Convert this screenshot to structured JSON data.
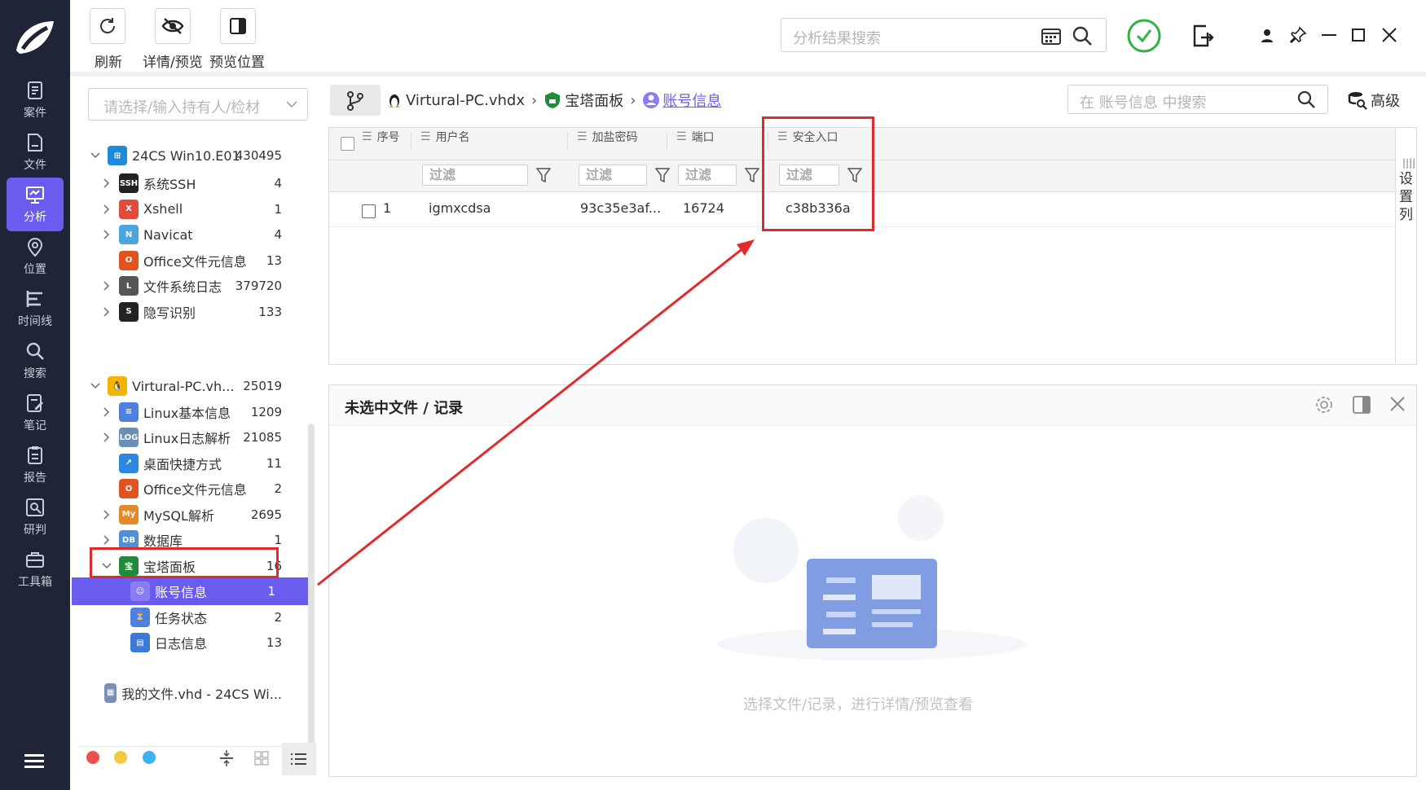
{
  "toolbar": {
    "refresh_label": "刷新",
    "detail_label": "详情/预览",
    "preview_pos_label": "预览位置",
    "search_placeholder": "分析结果搜索"
  },
  "nav": {
    "items": [
      {
        "label": "案件",
        "icon": "case-icon"
      },
      {
        "label": "文件",
        "icon": "file-icon"
      },
      {
        "label": "分析",
        "icon": "analysis-icon",
        "active": true
      },
      {
        "label": "位置",
        "icon": "location-icon"
      },
      {
        "label": "时间线",
        "icon": "timeline-icon"
      },
      {
        "label": "搜索",
        "icon": "search-icon"
      },
      {
        "label": "笔记",
        "icon": "note-icon"
      },
      {
        "label": "报告",
        "icon": "report-icon"
      },
      {
        "label": "研判",
        "icon": "judge-icon"
      },
      {
        "label": "工具箱",
        "icon": "toolbox-icon"
      }
    ]
  },
  "tree": {
    "select_placeholder": "请选择/输入持有人/检材",
    "groups": [
      {
        "label": "24CS Win10.E01",
        "count": "430495",
        "children": [
          {
            "label": "系统SSH",
            "count": "4"
          },
          {
            "label": "Xshell",
            "count": "1"
          },
          {
            "label": "Navicat",
            "count": "4"
          },
          {
            "label": "Office文件元信息",
            "count": "13"
          },
          {
            "label": "文件系统日志",
            "count": "379720"
          },
          {
            "label": "隐写识别",
            "count": "133"
          }
        ]
      },
      {
        "label": "Virtural-PC.vh...",
        "count": "25019",
        "children": [
          {
            "label": "Linux基本信息",
            "count": "1209"
          },
          {
            "label": "Linux日志解析",
            "count": "21085"
          },
          {
            "label": "桌面快捷方式",
            "count": "11"
          },
          {
            "label": "Office文件元信息",
            "count": "2"
          },
          {
            "label": "MySQL解析",
            "count": "2695"
          },
          {
            "label": "数据库",
            "count": "1"
          },
          {
            "label": "宝塔面板",
            "count": "16"
          },
          {
            "label": "账号信息",
            "count": "1"
          },
          {
            "label": "任务状态",
            "count": "2"
          },
          {
            "label": "日志信息",
            "count": "13"
          }
        ]
      },
      {
        "label": "我的文件.vhd - 24CS Wi...",
        "count": ""
      }
    ]
  },
  "breadcrumb": {
    "item1": "Virtural-PC.vhdx",
    "item2": "宝塔面板",
    "item3": "账号信息",
    "search_placeholder": "在 账号信息 中搜索",
    "advanced_label": "高级"
  },
  "grid": {
    "columns": [
      "序号",
      "用户名",
      "加盐密码",
      "端口",
      "安全入口"
    ],
    "filter_label": "过滤",
    "rows": [
      {
        "index": "1",
        "username": "igmxcdsa",
        "password": "93c35e3af...",
        "port": "16724",
        "entry": "c38b336a"
      }
    ],
    "settings_col_label": "设置列"
  },
  "detail": {
    "title": "未选中文件 / 记录",
    "empty_text": "选择文件/记录，进行详情/预览查看"
  },
  "colors": {
    "nav_bg": "#1f2537",
    "accent": "#6b5cf0",
    "highlight": "#e02b2b",
    "green": "#2fb344"
  }
}
